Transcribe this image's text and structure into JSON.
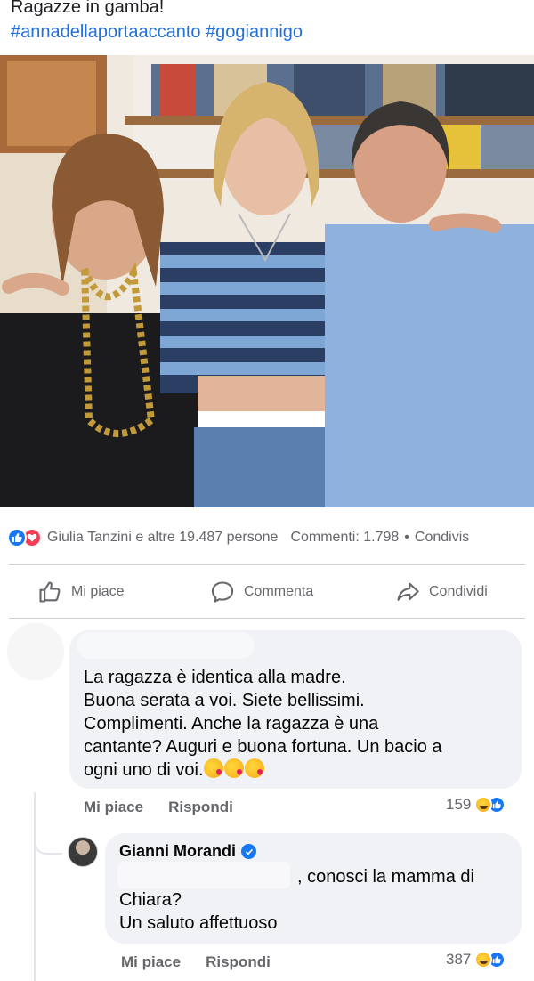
{
  "post": {
    "text": "Ragazze in gamba!",
    "hashtags": "#annadellaportaaccanto #gogiannigo"
  },
  "stats": {
    "reactions_text": "Giulia Tanzini e altre 19.487 persone",
    "comments_text": "Commenti: 1.798",
    "separator": "•",
    "shares_text": "Condivis"
  },
  "actions": {
    "like": "Mi piace",
    "comment": "Commenta",
    "share": "Condividi"
  },
  "comments": [
    {
      "text_lines": [
        "La ragazza  è  identica  alla madre.",
        "Buona serata  a voi. Siete bellissimi.",
        "Complimenti. Anche la ragazza è una",
        "cantante? Auguri  e buona  fortuna.  Un bacio  a",
        "ogni uno di voi."
      ],
      "like_label": "Mi piace",
      "reply_label": "Rispondi",
      "reaction_count": "159"
    },
    {
      "author": "Gianni Morandi",
      "text_lines": [
        ", conosci la mamma di",
        "Chiara?",
        "Un saluto affettuoso"
      ],
      "like_label": "Mi piace",
      "reply_label": "Rispondi",
      "reaction_count": "387"
    }
  ],
  "colors": {
    "hashtag": "#216fdb",
    "like_blue": "#1877f2",
    "love_red": "#f33e58",
    "muted_text": "#65676b",
    "bubble_bg": "#f0f2f5"
  }
}
